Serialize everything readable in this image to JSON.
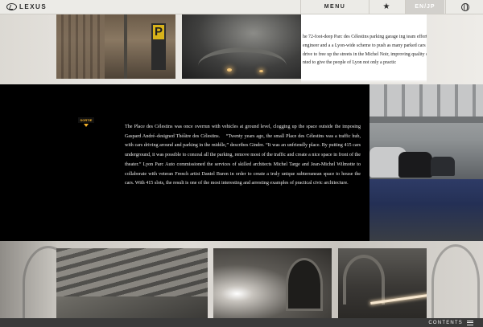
{
  "header": {
    "logo_text": "LEXUS",
    "menu_label": "MENU",
    "star_icon": "★",
    "lang_label": "EN/JP"
  },
  "top_text": "he 72-foot-deep Parc des Célestins parking garage ing team effort between architect, engineer and a a Lyon-wide scheme to push as many parked cars sible. It was a drive to free up the streets in the Michel Noir, improving quality of life for citizens nted to give the people of Lyon not only a practic",
  "story": "The Place des Célestins was once overrun with vehicles at ground level, clogging up the space outside the imposing Gaspard André–designed Théâtre des Célestins.    “Twenty years ago, the small Place des Célestins was a traffic hub, with cars driving around and parking in the middle,” describes Gindre. “It was an unfriendly place. By putting 415 cars underground, it was possible to conceal all the parking, remove most of the traffic and create a nice space in front of the theater.” Lyon Parc Auto commissioned the services of skilled architects Michel Targe and Jean-Michel Wilmotte to collaborate with veteran French artist Daniel Buren in order to create a truly unique subterranean space to house the cars. With 415 slots, the result is one of the most interesting and arresting examples of practical civic architecture.",
  "photos": {
    "sign_letter": "P",
    "exit_sign": "SORTIE"
  },
  "footer": {
    "contents_label": "CONTENTS"
  }
}
